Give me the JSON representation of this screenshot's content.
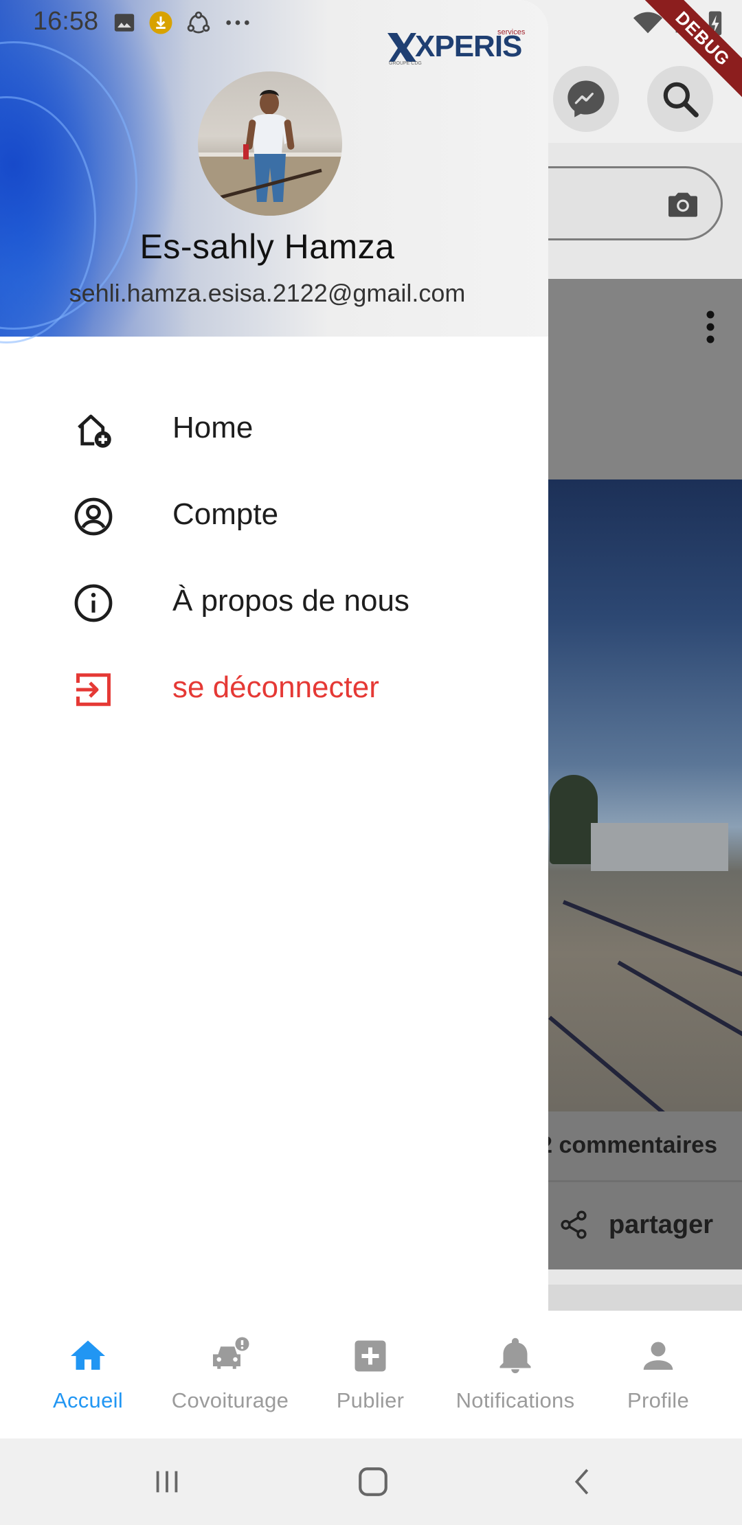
{
  "status_bar": {
    "time": "16:58"
  },
  "background_app": {
    "comments": "2 commentaires",
    "share": "partager"
  },
  "debug_banner": "DEBUG",
  "drawer": {
    "logo_text": "XPERIS",
    "logo_services": "services",
    "logo_group": "GROUPE CDG",
    "user_name": "Es-sahly Hamza",
    "user_email": "sehli.hamza.esisa.2122@gmail.com",
    "menu": [
      {
        "label": "Home",
        "icon": "home-add-icon"
      },
      {
        "label": "Compte",
        "icon": "account-circle-icon"
      },
      {
        "label": "À propos de nous",
        "icon": "info-icon"
      },
      {
        "label": "se déconnecter",
        "icon": "logout-icon",
        "color": "#e53935"
      }
    ]
  },
  "bottom_nav": {
    "items": [
      {
        "label": "Accueil",
        "icon": "home-icon",
        "active": true
      },
      {
        "label": "Covoiturage",
        "icon": "car-alert-icon"
      },
      {
        "label": "Publier",
        "icon": "add-box-icon"
      },
      {
        "label": "Notifications",
        "icon": "bell-icon"
      },
      {
        "label": "Profile",
        "icon": "person-icon"
      }
    ],
    "active_color": "#2196f3",
    "inactive_color": "#9b9b9b"
  }
}
